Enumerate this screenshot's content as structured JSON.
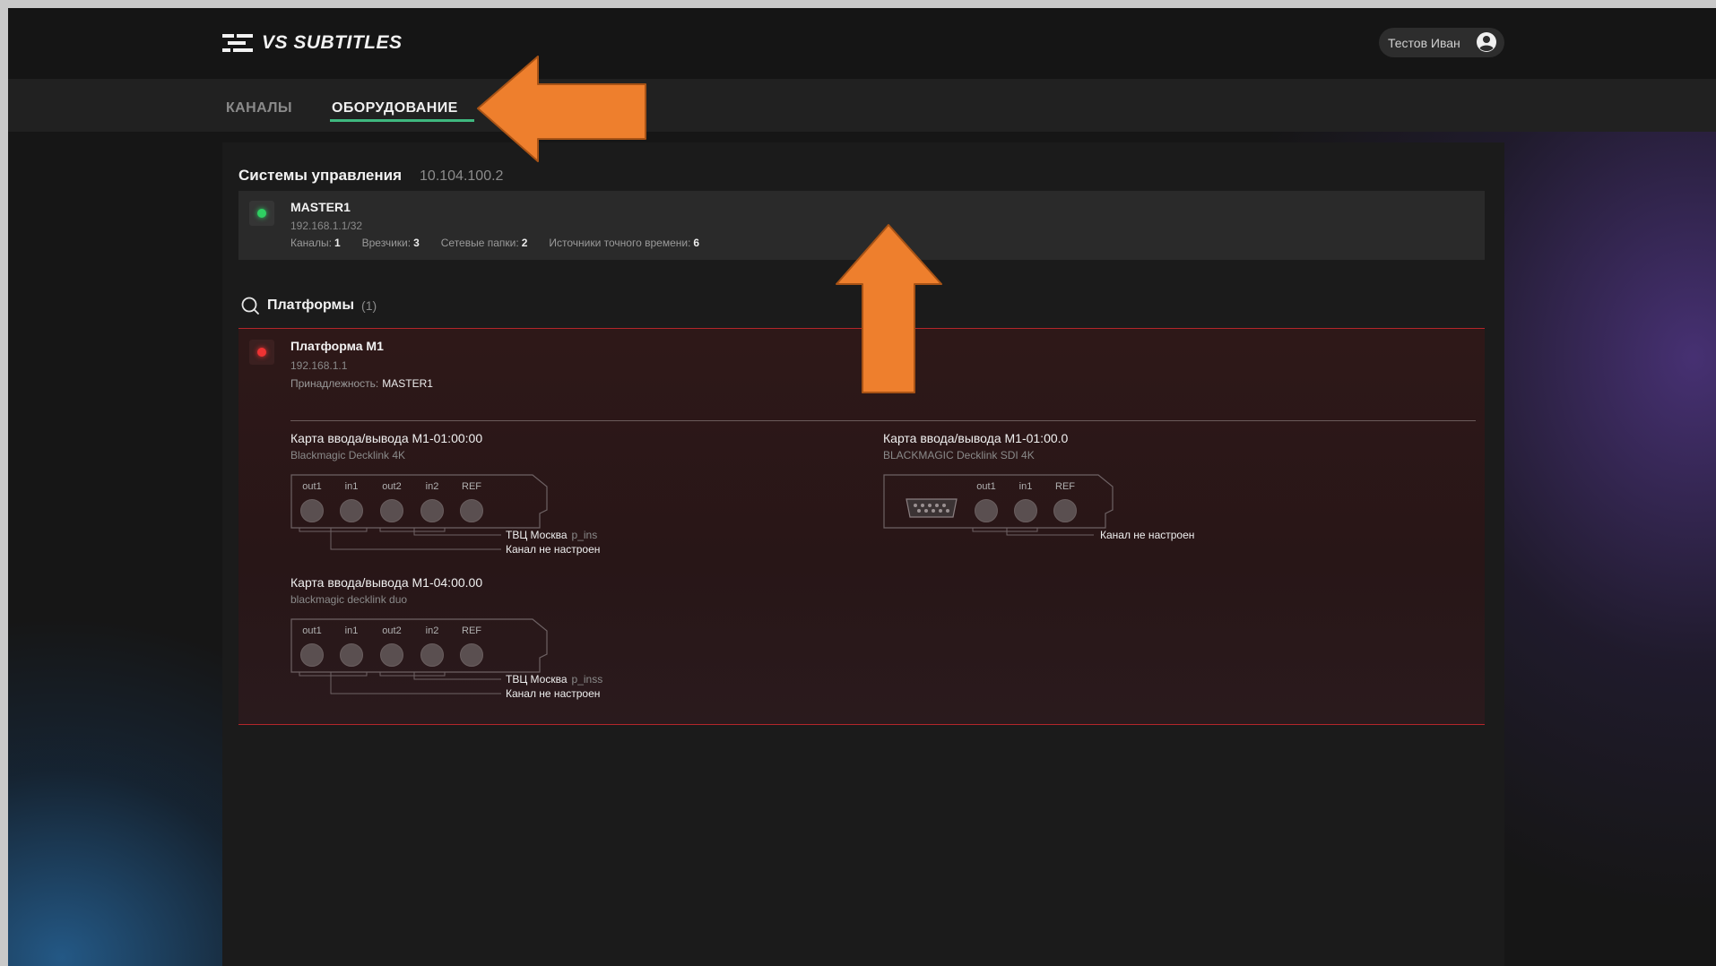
{
  "app": {
    "title": "VS SUBTITLES",
    "accent": "#3fb87f"
  },
  "user": {
    "name": "Тестов Иван",
    "icon": "user-avatar-icon"
  },
  "nav": {
    "tabs": [
      {
        "label": "КАНАЛЫ"
      },
      {
        "label": "ОБОРУДОВАНИЕ"
      }
    ],
    "active": 1
  },
  "control": {
    "title": "Системы управления",
    "ip": "10.104.100.2",
    "master": {
      "name": "MASTER1",
      "ip": "192.168.1.1/32",
      "status": "online",
      "stats": [
        {
          "label": "Каналы:",
          "value": "1"
        },
        {
          "label": "Врезчики:",
          "value": "3"
        },
        {
          "label": "Сетевые папки:",
          "value": "2"
        },
        {
          "label": "Источники точного времени:",
          "value": "6"
        }
      ]
    }
  },
  "platforms": {
    "title": "Платформы",
    "count": "(1)",
    "items": [
      {
        "name": "Платформа M1",
        "ip": "192.168.1.1",
        "status": "offline",
        "affiliation_label": "Принадлежность:",
        "affiliation_value": "MASTER1",
        "cards": [
          {
            "title": "Карта ввода/вывода M1-01:00:00",
            "model": "Blackmagic Decklink 4K",
            "ports": [
              "out1",
              "in1",
              "out2",
              "in2",
              "REF"
            ],
            "connections": [
              {
                "channel": "ТВЦ Москва",
                "alias": "p_ins"
              },
              {
                "channel": "Канал не настроен",
                "alias": ""
              }
            ]
          },
          {
            "title": "Карта ввода/вывода M1-01:00.0",
            "model": "BLACKMAGIC Decklink SDI 4K",
            "ports": [
              "out1",
              "in1",
              "REF"
            ],
            "connections": [
              {
                "channel": "Канал не настроен",
                "alias": ""
              }
            ]
          },
          {
            "title": "Карта ввода/вывода M1-04:00.00",
            "model": "blackmagic decklink duo",
            "ports": [
              "out1",
              "in1",
              "out2",
              "in2",
              "REF"
            ],
            "connections": [
              {
                "channel": "ТВЦ Москва",
                "alias": "p_inss"
              },
              {
                "channel": "Канал не настроен",
                "alias": ""
              }
            ]
          }
        ]
      }
    ]
  },
  "annotations": {
    "arrow_color": "#ee7f2d"
  }
}
